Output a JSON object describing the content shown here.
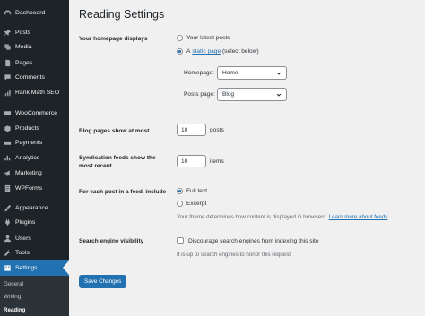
{
  "sidebar": {
    "items": [
      {
        "label": "Dashboard",
        "icon": "dashboard-icon"
      },
      {
        "label": "Posts",
        "icon": "pin-icon"
      },
      {
        "label": "Media",
        "icon": "media-icon"
      },
      {
        "label": "Pages",
        "icon": "pages-icon"
      },
      {
        "label": "Comments",
        "icon": "comments-icon"
      },
      {
        "label": "Rank Math SEO",
        "icon": "chart-icon"
      },
      {
        "label": "WooCommerce",
        "icon": "woocommerce-icon"
      },
      {
        "label": "Products",
        "icon": "products-icon"
      },
      {
        "label": "Payments",
        "icon": "payments-icon"
      },
      {
        "label": "Analytics",
        "icon": "analytics-icon"
      },
      {
        "label": "Marketing",
        "icon": "megaphone-icon"
      },
      {
        "label": "WPForms",
        "icon": "forms-icon"
      },
      {
        "label": "Appearance",
        "icon": "brush-icon"
      },
      {
        "label": "Plugins",
        "icon": "plugin-icon"
      },
      {
        "label": "Users",
        "icon": "users-icon"
      },
      {
        "label": "Tools",
        "icon": "wrench-icon"
      },
      {
        "label": "Settings",
        "icon": "settings-icon"
      }
    ],
    "submenu": [
      "General",
      "Writing",
      "Reading"
    ]
  },
  "page": {
    "title": "Reading Settings"
  },
  "homepage": {
    "label": "Your homepage displays",
    "option_latest": "Your latest posts",
    "option_static_prefix": "A",
    "option_static_link": "static page",
    "option_static_suffix": "(select below)",
    "homepage_label": "Homepage:",
    "homepage_value": "Home",
    "posts_page_label": "Posts page:",
    "posts_page_value": "Blog"
  },
  "blog_pages": {
    "label": "Blog pages show at most",
    "value": "10",
    "unit": "posts"
  },
  "syndication": {
    "label": "Syndication feeds show the most recent",
    "value": "10",
    "unit": "items"
  },
  "feed": {
    "label": "For each post in a feed, include",
    "option_full": "Full text",
    "option_excerpt": "Excerpt",
    "description_prefix": "Your theme determines how content is displayed in browsers.",
    "description_link": "Learn more about feeds"
  },
  "search_visibility": {
    "label": "Search engine visibility",
    "checkbox_label": "Discourage search engines from indexing this site",
    "description": "It is up to search engines to honor this request."
  },
  "buttons": {
    "save": "Save Changes"
  },
  "colors": {
    "sidebar_bg": "#1d2327",
    "accent": "#2271b1",
    "page_bg": "#f0f0f1"
  }
}
